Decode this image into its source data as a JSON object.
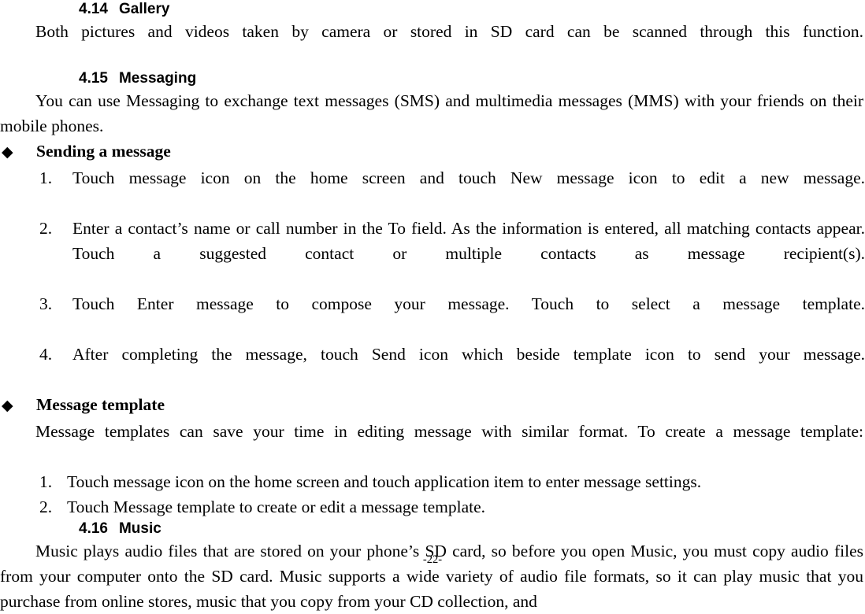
{
  "document": {
    "page_number_label": "-22-"
  },
  "sections": {
    "gallery": {
      "number": "4.14",
      "title": "Gallery",
      "body": "Both pictures and videos taken by camera or stored in SD card can be scanned through this function."
    },
    "messaging": {
      "number": "4.15",
      "title": "Messaging",
      "intro": "You can use Messaging to exchange text messages (SMS) and multimedia messages (MMS) with your friends on their mobile phones.",
      "sending": {
        "bullet_glyph": "◆",
        "label": "Sending a message",
        "steps": [
          {
            "num": "1.",
            "text": "Touch message icon on the home screen and touch New message icon to edit a new message."
          },
          {
            "num": "2.",
            "text": "Enter a contact’s name or call number in the To field. As the information is entered, all matching contacts appear. Touch a suggested contact or multiple contacts as message recipient(s)."
          },
          {
            "num": "3.",
            "text": "Touch Enter message to compose your message. Touch to select a message template."
          },
          {
            "num": "4.",
            "text": "After completing the message, touch Send icon which beside template icon to send your message."
          }
        ]
      },
      "template": {
        "bullet_glyph": "◆",
        "label": "Message template",
        "intro": "Message templates can save your time in editing message with similar format. To create a message template:",
        "steps": [
          {
            "num": "1.",
            "text": "Touch message icon on the home screen and touch application item to enter message settings."
          },
          {
            "num": "2.",
            "text": "Touch Message template to create or edit a message template."
          }
        ]
      }
    },
    "music": {
      "number": "4.16",
      "title": "Music",
      "body": "Music plays audio files that are stored on your phone’s SD card, so before you open Music, you must copy audio files from your computer onto the SD card. Music supports a wide variety of audio file formats, so it can play music that you purchase from online stores, music that you copy from your CD collection, and"
    }
  }
}
